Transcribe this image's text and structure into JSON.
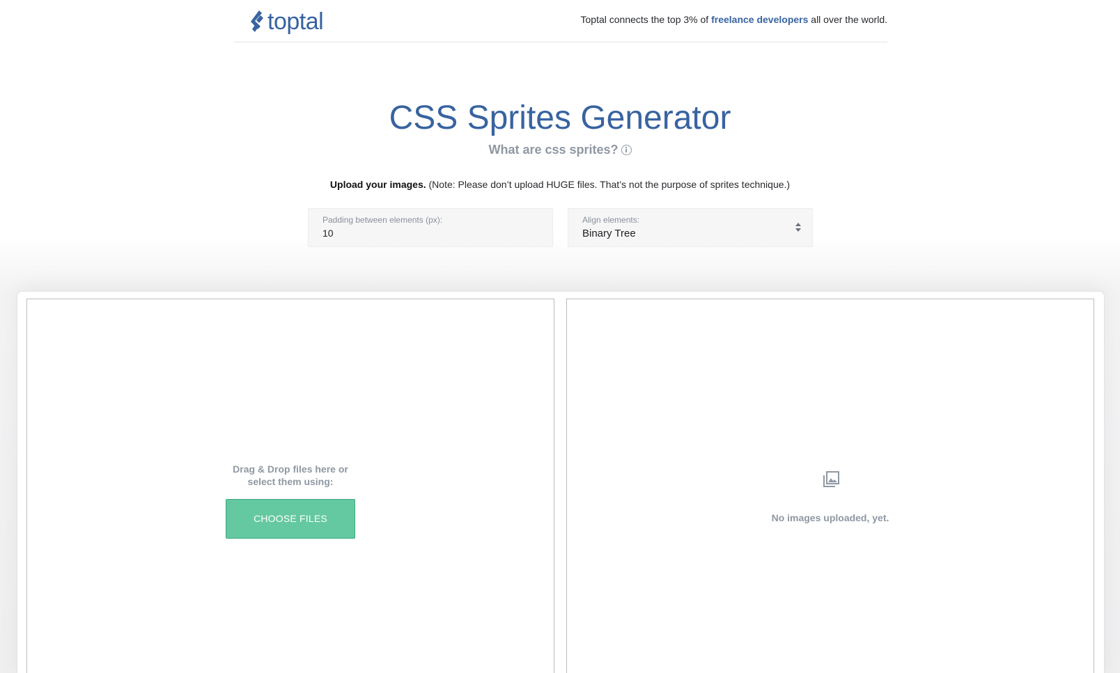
{
  "header": {
    "logo_text": "toptal",
    "tagline_prefix": "Toptal connects the top 3% of ",
    "tagline_link": "freelance developers",
    "tagline_suffix": " all over the world."
  },
  "hero": {
    "title": "CSS Sprites Generator",
    "subtitle": "What are css sprites?",
    "upload_label": "Upload your images.",
    "upload_note": " (Note: Please don’t upload HUGE files. That’s not the purpose of sprites technique.)"
  },
  "settings": {
    "padding_label": "Padding between elements (px):",
    "padding_value": "10",
    "align_label": "Align elements:",
    "align_value": "Binary Tree"
  },
  "upload_panel": {
    "drop_line1": "Drag & Drop files here or",
    "drop_line2": "select them using:",
    "button_label": "CHOOSE FILES"
  },
  "preview_panel": {
    "icon": "images-icon",
    "empty_text": "No images uploaded, yet."
  },
  "colors": {
    "brand_blue": "#3863a0",
    "muted_gray": "#8f98a3",
    "button_green": "#64c8a1"
  }
}
